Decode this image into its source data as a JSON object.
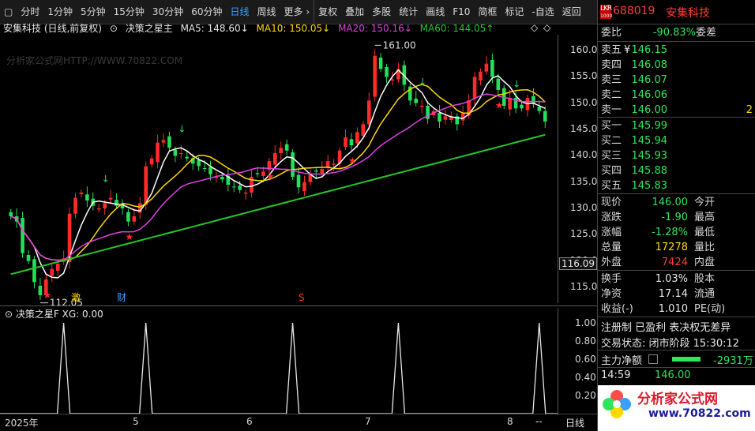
{
  "toolbar": {
    "items": [
      "分时",
      "1分钟",
      "5分钟",
      "15分钟",
      "30分钟",
      "60分钟",
      "日线",
      "周线",
      "更多 ›",
      "复权",
      "叠加",
      "多股",
      "统计",
      "画线",
      "F10",
      "简框",
      "标记",
      "-自选",
      "返回"
    ],
    "active": "日线"
  },
  "info": {
    "title": "安集科技 (日线,前复权)",
    "indicator": "决策之星主",
    "ma5": "MA5: 148.60↓",
    "ma10": "MA10: 150.05↓",
    "ma20": "MA20: 150.16↓",
    "ma60": "MA60: 144.05↑"
  },
  "watermark": "分析家公式网HTTP://WWW.70822.COM",
  "chart_data": {
    "type": "candlestick",
    "y_ticks": [
      "160.0",
      "155.0",
      "150.0",
      "145.0",
      "140.0",
      "135.0",
      "130.0",
      "125.0",
      "120.0",
      "115.0"
    ],
    "ylim": [
      112,
      163
    ],
    "annotations": [
      "161.00",
      "112.05"
    ],
    "current_price": "116.09",
    "event_marks": [
      "激",
      "财",
      "S"
    ],
    "x_ticks": [
      "2025年",
      "5",
      "6",
      "7",
      "8"
    ],
    "closes": [
      128.5,
      127.5,
      121.5,
      120.0,
      116.0,
      113.5,
      116.5,
      118.5,
      119.5,
      120.5,
      129.0,
      132.0,
      133.0,
      131.5,
      130.5,
      130.0,
      131.0,
      132.0,
      130.5,
      130.0,
      127.5,
      128.5,
      131.0,
      138.0,
      139.5,
      142.5,
      143.0,
      141.5,
      140.0,
      140.5,
      139.5,
      138.5,
      138.0,
      137.5,
      136.5,
      136.0,
      135.5,
      134.5,
      134.0,
      133.5,
      133.0,
      136.0,
      136.5,
      137.0,
      139.0,
      140.5,
      141.5,
      141.0,
      136.0,
      134.0,
      135.0,
      136.5,
      137.0,
      137.5,
      139.0,
      138.5,
      141.0,
      143.5,
      142.0,
      144.5,
      146.0,
      150.5,
      159.0,
      156.5,
      155.0,
      154.5,
      156.5,
      153.5,
      150.5,
      150.0,
      149.5,
      147.0,
      148.5,
      146.5,
      147.5,
      147.5,
      146.0,
      148.0,
      150.5,
      155.0,
      156.0,
      157.5,
      155.0,
      152.5,
      149.5,
      151.0,
      149.0,
      149.0,
      151.0,
      150.0,
      148.5,
      146.5
    ],
    "ma_series": [
      {
        "name": "MA5",
        "color": "#ffffff"
      },
      {
        "name": "MA10",
        "color": "#ffd800"
      },
      {
        "name": "MA20",
        "color": "#e040e0"
      },
      {
        "name": "MA60",
        "color": "#22c62a"
      }
    ]
  },
  "indicator_panel": {
    "title": "决策之星F",
    "xg": "XG: 0.00",
    "y_ticks": [
      "1.00",
      "0.80",
      "0.60",
      "0.40",
      "0.20"
    ],
    "spikes_at": [
      9,
      23,
      48,
      66,
      90
    ]
  },
  "quote": {
    "code_badge": "LKR",
    "code_sub": "1000",
    "code": "688019",
    "name": "安集科技",
    "weibi_label": "委比",
    "weibi_value": "-90.83%",
    "weicha_label": "委差",
    "asks": [
      {
        "label": "卖五",
        "price": "146.15",
        "vol": ""
      },
      {
        "label": "卖四",
        "price": "146.08",
        "vol": ""
      },
      {
        "label": "卖三",
        "price": "146.07",
        "vol": ""
      },
      {
        "label": "卖二",
        "price": "146.06",
        "vol": ""
      },
      {
        "label": "卖一",
        "price": "146.00",
        "vol": "2"
      }
    ],
    "bids": [
      {
        "label": "买一",
        "price": "145.99"
      },
      {
        "label": "买二",
        "price": "145.94"
      },
      {
        "label": "买三",
        "price": "145.93"
      },
      {
        "label": "买四",
        "price": "145.88"
      },
      {
        "label": "买五",
        "price": "145.83"
      }
    ],
    "yen": "¥",
    "stats": [
      {
        "label": "现价",
        "value": "146.00",
        "extra": "今开",
        "cls": "down"
      },
      {
        "label": "涨跌",
        "value": "-1.90",
        "extra": "最高",
        "cls": "down"
      },
      {
        "label": "涨幅",
        "value": "-1.28%",
        "extra": "最低",
        "cls": "down"
      },
      {
        "label": "总量",
        "value": "17278",
        "extra": "量比",
        "cls": "yellow"
      },
      {
        "label": "外盘",
        "value": "7424",
        "extra": "内盘",
        "cls": "up"
      }
    ],
    "stats2": [
      {
        "label": "换手",
        "value": "1.03%",
        "extra": "股本"
      },
      {
        "label": "净资",
        "value": "17.14",
        "extra": "流通"
      },
      {
        "label": "收益(-)",
        "value": "1.010",
        "extra": "PE(动)"
      }
    ],
    "tags": "注册制 已盈利 表决权无差异",
    "status": "交易状态: 闭市阶段 15:30:12",
    "net_flow_label": "主力净额",
    "net_flow_value": "-2931万",
    "last_trade_time": "14:59",
    "last_trade_price": "146.00"
  },
  "bottom_tab": "日线",
  "logo": {
    "title": "分析家公式网",
    "url": "www.70822.com"
  }
}
